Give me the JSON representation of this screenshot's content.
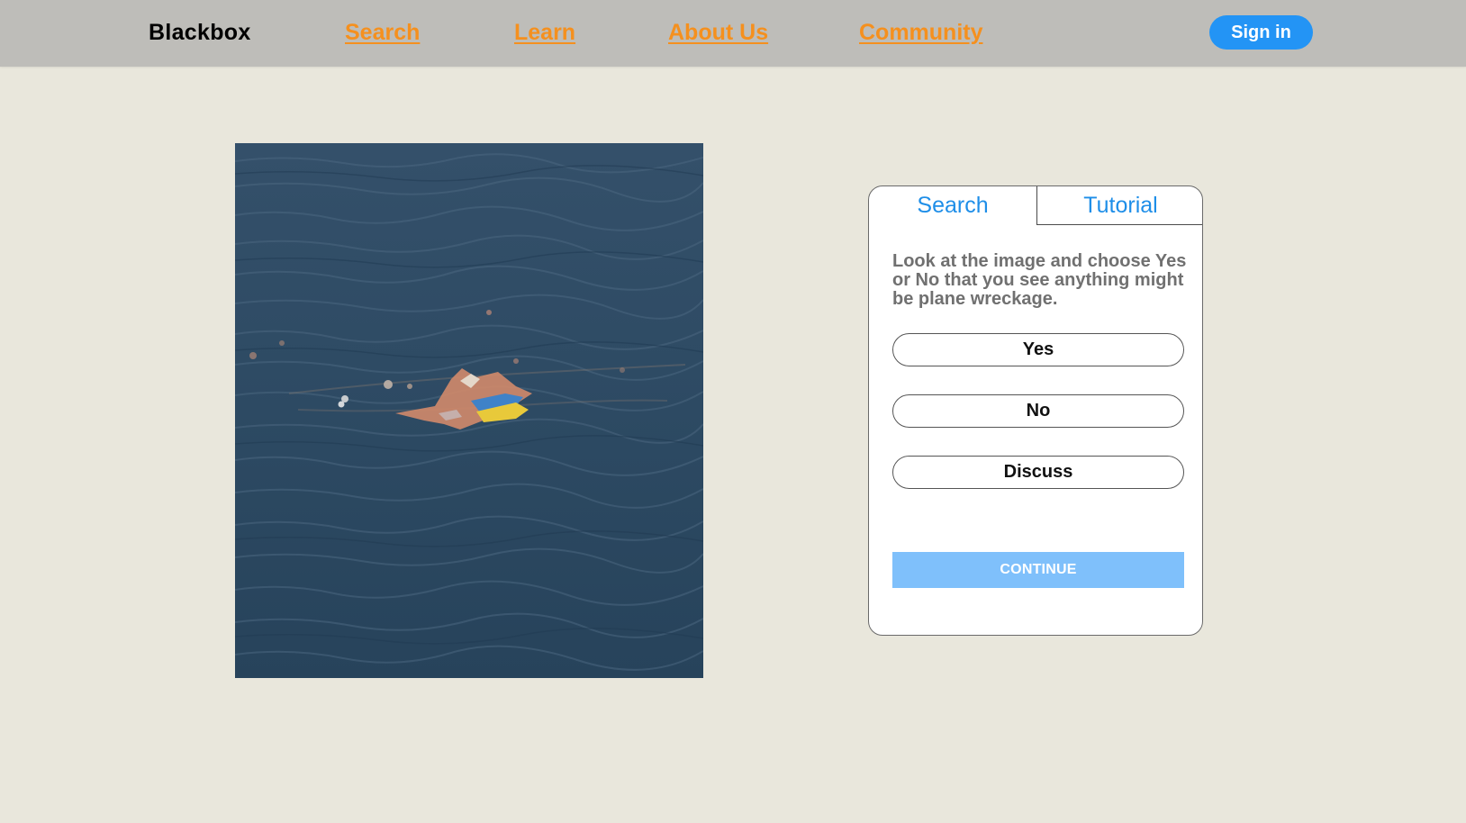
{
  "header": {
    "brand": "Blackbox",
    "nav": [
      "Search",
      "Learn",
      "About Us",
      "Community"
    ],
    "signin_label": "Sign in"
  },
  "image": {
    "description_icon": "ocean-debris-photo"
  },
  "panel": {
    "tabs": [
      "Search",
      "Tutorial"
    ],
    "active_tab": "Search",
    "instructions": "Look at the image and choose Yes or No that you see anything might be plane wreckage.",
    "choices": [
      "Yes",
      "No",
      "Discuss"
    ],
    "continue_label": "CONTINUE"
  },
  "colors": {
    "header_bg": "#bebdb9",
    "page_bg": "#e9e7dc",
    "nav_link": "#f5901e",
    "accent": "#2394f5",
    "continue_bg": "#7fc0fb"
  }
}
